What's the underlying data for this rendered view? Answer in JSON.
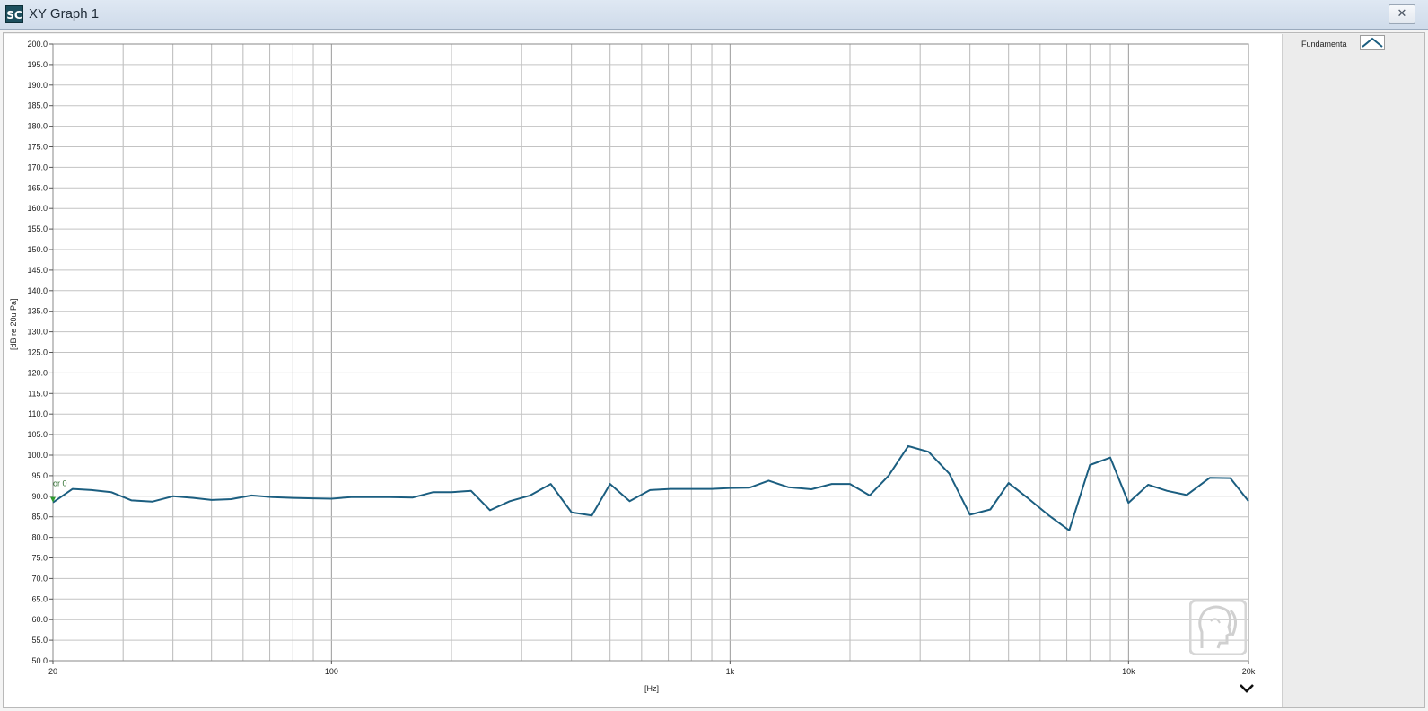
{
  "window": {
    "icon_text": "SC",
    "title": "XY Graph 1",
    "close_icon": "close-icon"
  },
  "legend": {
    "label": "Fundamenta",
    "swatch_icon": "line-sample-icon"
  },
  "chart_data": {
    "type": "line",
    "title": "",
    "xlabel": "[Hz]",
    "ylabel": "[dB re 20u Pa]",
    "x_scale": "log",
    "xlim": [
      20,
      20000
    ],
    "ylim": [
      50,
      200
    ],
    "grid": true,
    "legend_position": "right",
    "x_tick_labels": [
      {
        "value": 20,
        "label": "20"
      },
      {
        "value": 100,
        "label": "100"
      },
      {
        "value": 1000,
        "label": "1k"
      },
      {
        "value": 10000,
        "label": "10k"
      },
      {
        "value": 20000,
        "label": "20k"
      }
    ],
    "y_ticks": [
      50,
      55,
      60,
      65,
      70,
      75,
      80,
      85,
      90,
      95,
      100,
      105,
      110,
      115,
      120,
      125,
      130,
      135,
      140,
      145,
      150,
      155,
      160,
      165,
      170,
      175,
      180,
      185,
      190,
      195,
      200
    ],
    "cursor": {
      "label": "or 0",
      "x": 20,
      "y": 88.5,
      "color": "#2e9a2e"
    },
    "series": [
      {
        "name": "Fundamenta",
        "color": "#1b5e80",
        "x": [
          20,
          22.4,
          25,
          28,
          31.5,
          35.5,
          40,
          45,
          50,
          56,
          63,
          71,
          80,
          90,
          100,
          112,
          125,
          140,
          160,
          180,
          200,
          224,
          250,
          280,
          315,
          355,
          400,
          450,
          500,
          560,
          630,
          710,
          800,
          900,
          1000,
          1120,
          1250,
          1400,
          1600,
          1800,
          2000,
          2240,
          2500,
          2800,
          3150,
          3550,
          4000,
          4500,
          5000,
          5600,
          6300,
          7100,
          8000,
          9000,
          10000,
          11200,
          12500,
          14000,
          16000,
          18000,
          20000
        ],
        "y": [
          88.5,
          91.8,
          91.5,
          91.0,
          89.0,
          88.7,
          90.0,
          89.6,
          89.1,
          89.3,
          90.2,
          89.8,
          89.6,
          89.5,
          89.4,
          89.8,
          89.8,
          89.8,
          89.7,
          91.0,
          91.0,
          91.3,
          86.6,
          88.8,
          90.2,
          93.0,
          86.1,
          85.3,
          93.0,
          88.8,
          91.5,
          91.8,
          91.8,
          91.8,
          92.0,
          92.1,
          93.8,
          92.2,
          91.7,
          93.0,
          93.0,
          90.2,
          95.0,
          102.2,
          100.8,
          95.5,
          85.5,
          86.8,
          93.2,
          89.5,
          85.4,
          81.7,
          97.6,
          99.4,
          88.4,
          92.8,
          91.3,
          90.3,
          94.5,
          94.4,
          88.8
        ]
      }
    ]
  }
}
